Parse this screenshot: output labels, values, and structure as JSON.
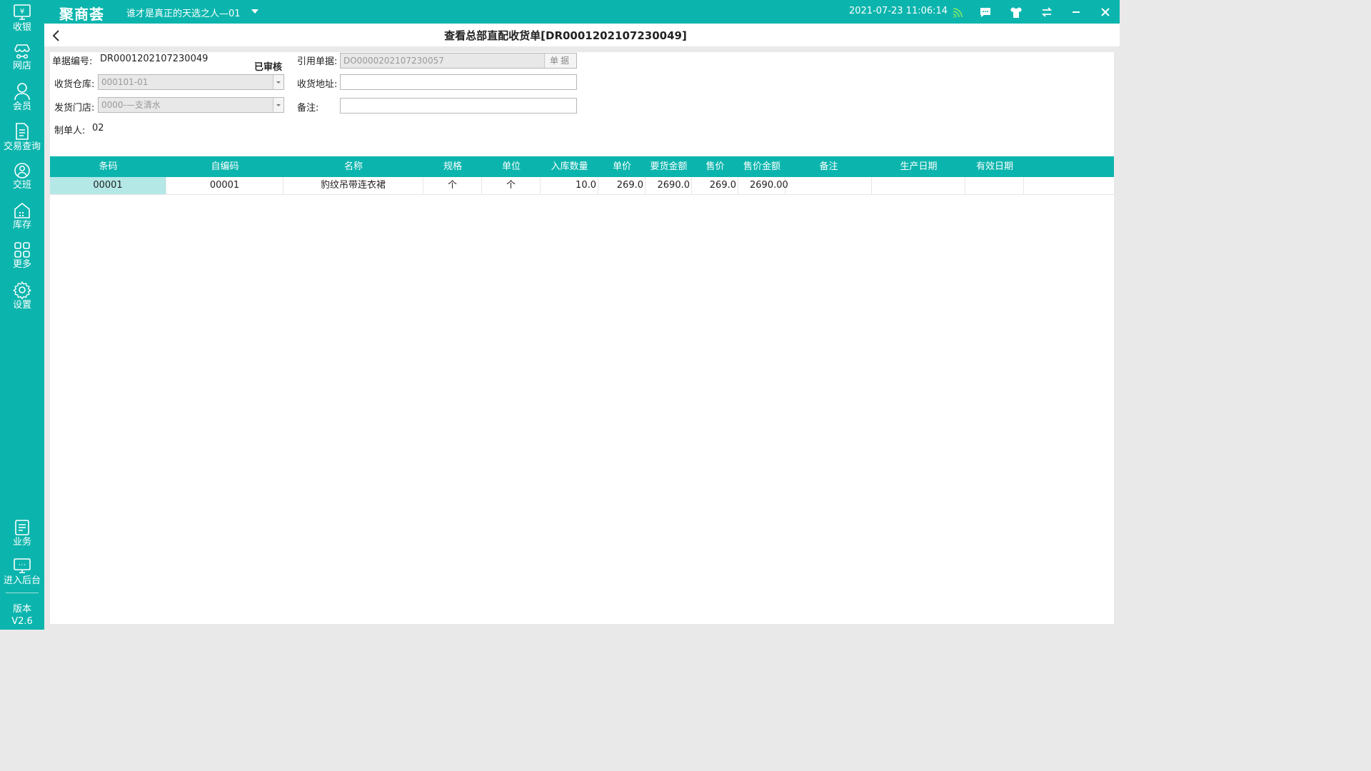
{
  "sidebar": {
    "items": [
      {
        "label": "收银",
        "icon": "cashier-icon"
      },
      {
        "label": "网店",
        "icon": "online-store-icon"
      },
      {
        "label": "会员",
        "icon": "member-icon"
      },
      {
        "label": "交易查询",
        "icon": "transaction-query-icon"
      },
      {
        "label": "交班",
        "icon": "shift-handover-icon"
      },
      {
        "label": "库存",
        "icon": "inventory-icon"
      },
      {
        "label": "更多",
        "icon": "more-grid-icon"
      },
      {
        "label": "设置",
        "icon": "settings-gear-icon"
      }
    ],
    "bottom_items": [
      {
        "label": "业务",
        "icon": "business-icon"
      },
      {
        "label": "进入后台",
        "icon": "backend-monitor-icon"
      }
    ],
    "version_label": "版本",
    "version_value": "V2.6"
  },
  "topbar": {
    "logo": "聚商荟",
    "store_name": "谁才是真正的天选之人—01",
    "datetime": "2021-07-23 11:06:14",
    "icons": [
      "wifi-signal-icon",
      "message-icon",
      "shirt-skin-icon",
      "switch-icon",
      "minimize-icon",
      "close-icon"
    ]
  },
  "title": "查看总部直配收货单[DR0001202107230049]",
  "form": {
    "doc_no_label": "单据编号:",
    "doc_no_value": "DR0001202107230049",
    "status": "已审核",
    "ref_doc_label": "引用单据:",
    "ref_doc_value": "DO0000202107230057",
    "ref_doc_button": "单据",
    "warehouse_label": "收货仓库:",
    "warehouse_value": "000101-01",
    "address_label": "收货地址:",
    "address_value": "",
    "store_label": "发货门店:",
    "store_value": "0000-—支清水",
    "remark_label": "备注:",
    "remark_value": "",
    "creator_label": "制单人:",
    "creator_value": "02"
  },
  "table": {
    "columns": [
      "条码",
      "自编码",
      "名称",
      "规格",
      "单位",
      "入库数量",
      "单价",
      "要货金额",
      "售价",
      "售价金额",
      "备注",
      "生产日期",
      "有效日期"
    ],
    "rows": [
      [
        "00001",
        "00001",
        "豹纹吊带连衣裙",
        "个",
        "个",
        "10.0",
        "269.0",
        "2690.0",
        "269.0",
        "2690.00",
        "",
        "",
        ""
      ]
    ]
  },
  "colors": {
    "accent": "#0bb5ad",
    "selected_cell": "#b3e8e6"
  }
}
